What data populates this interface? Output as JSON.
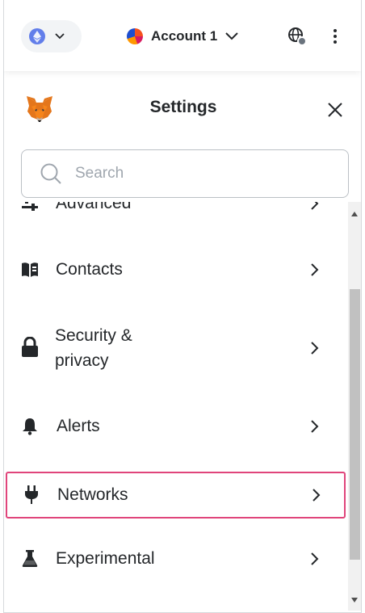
{
  "header": {
    "network_icon": "ethereum-icon",
    "account_name": "Account 1",
    "connected_sites_icon": "globe-icon",
    "menu_icon": "kebab-menu-icon"
  },
  "settings": {
    "title": "Settings",
    "logo": "metamask-fox-logo",
    "close_icon": "close-icon"
  },
  "search": {
    "placeholder": "Search",
    "value": ""
  },
  "items": [
    {
      "label": "Advanced",
      "icon": "sliders-icon",
      "selected": false
    },
    {
      "label": "Contacts",
      "icon": "address-book-icon",
      "selected": false
    },
    {
      "label": "Security & privacy",
      "icon": "lock-icon",
      "selected": false
    },
    {
      "label": "Alerts",
      "icon": "bell-icon",
      "selected": false
    },
    {
      "label": "Networks",
      "icon": "plug-icon",
      "selected": true
    },
    {
      "label": "Experimental",
      "icon": "flask-icon",
      "selected": false
    }
  ],
  "colors": {
    "selected_border": "#e0457b",
    "ethereum": "#627eea"
  }
}
